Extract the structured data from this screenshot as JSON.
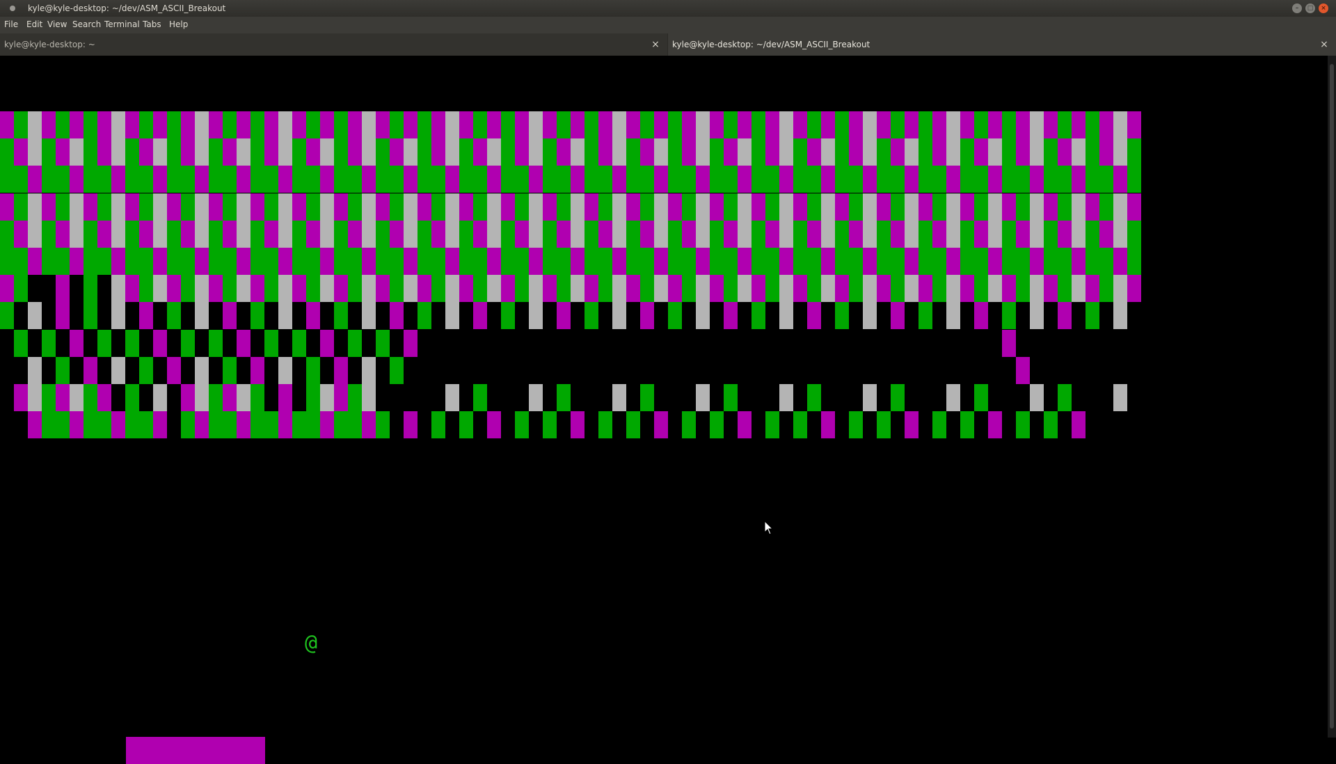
{
  "window": {
    "title": "kyle@kyle-desktop: ~/dev/ASM_ASCII_Breakout"
  },
  "menu": [
    "File",
    "Edit",
    "View",
    "Search",
    "Terminal",
    "Tabs",
    "Help"
  ],
  "tabs": [
    {
      "label": "kyle@kyle-desktop: ~",
      "active": false
    },
    {
      "label": "kyle@kyle-desktop: ~/dev/ASM_ASCII_Breakout",
      "active": true
    }
  ],
  "game": {
    "ball_char": "@",
    "colors": {
      "magenta": "#b000b0",
      "green": "#00a800",
      "gray": "#b4b4b4"
    },
    "brick_rows": [
      "MGGMGMGMGMGMGMGMGMGMGMGMGMGMGMGMGMGMGMGMGMGMGMGMGMGMGMGMGMGMGMGMGMGMGMGMGMGMGMGMGM",
      "GMGGMGGMGGMGGMGGMGGMGGMGGMGGMGGMGGMGGMGGMGGMGGMGGMGGMGGMGGMGGMGGMGGMGGMGGMGGMGGMGG",
      "GGMGGMGGMGGMGGMGGMGGMGGMGGMGGMGGMGGMGGMGGMGGMGGMGGMGGMGGMGGMGGMGGMGGMGGMGGMGGMGGMG",
      "MGGMGGMGGMGGMGGMGGMGGMGGMGGMGGMGGMGGMGGMGGMGGMGGMGGMGGMGGMGGMGGMGGMGGMGGMGGMGGMGGM",
      "GMGGMGGMGGMGGMGGMGGMGGMGGMGGMGGMGGMGGMGGMGGMGGMGGMGGMGGMGGMGGMGGMGGMGGMGGMGGMGGMGG",
      "GGMGGMGGMGGMGGMGGMGGMGGMGGMGGMGGMGGMGGMGGMGGMGGMGGMGGMGGMGGMGGMGGMGGMGGMGGMGGMGGMG",
      "MG..M.G.GMGGMGGMGGMGGMGGMGGMGGMGGMGGMGGMGGMGGMGGMGGMGGMGGMGGMGGMGGMGGMGGMGGMGGMGGM",
      "G.G.M.G.G.M.G.G.M.G.G.M.G.G.M.G.G.M.G.G.M.G.G.M.G.G.M.G.G.M.G.G.M.G.G.M.G.G.M.G.G",
      ".G.G.M.G.G.M.G.G.M.G.G.M.G.G.M..........................................M.",
      "..G.G.M.G.G.M.G.G.M.G.G.M.G.G............................................M",
      ".MGGMGGM.G.G.MGGMGG.M.GGMGG.....G.G...G.G...G.G...G.G...G.G...G.G...G.G...G.G...G",
      "..MGGMGGMGGM.GMGGMGGMGGMGGMG.M.G.G.M.G.G.M.G.G.M.G.G.M.G.G.M.G.G.M.G.G.M.G.G.M."
    ]
  }
}
